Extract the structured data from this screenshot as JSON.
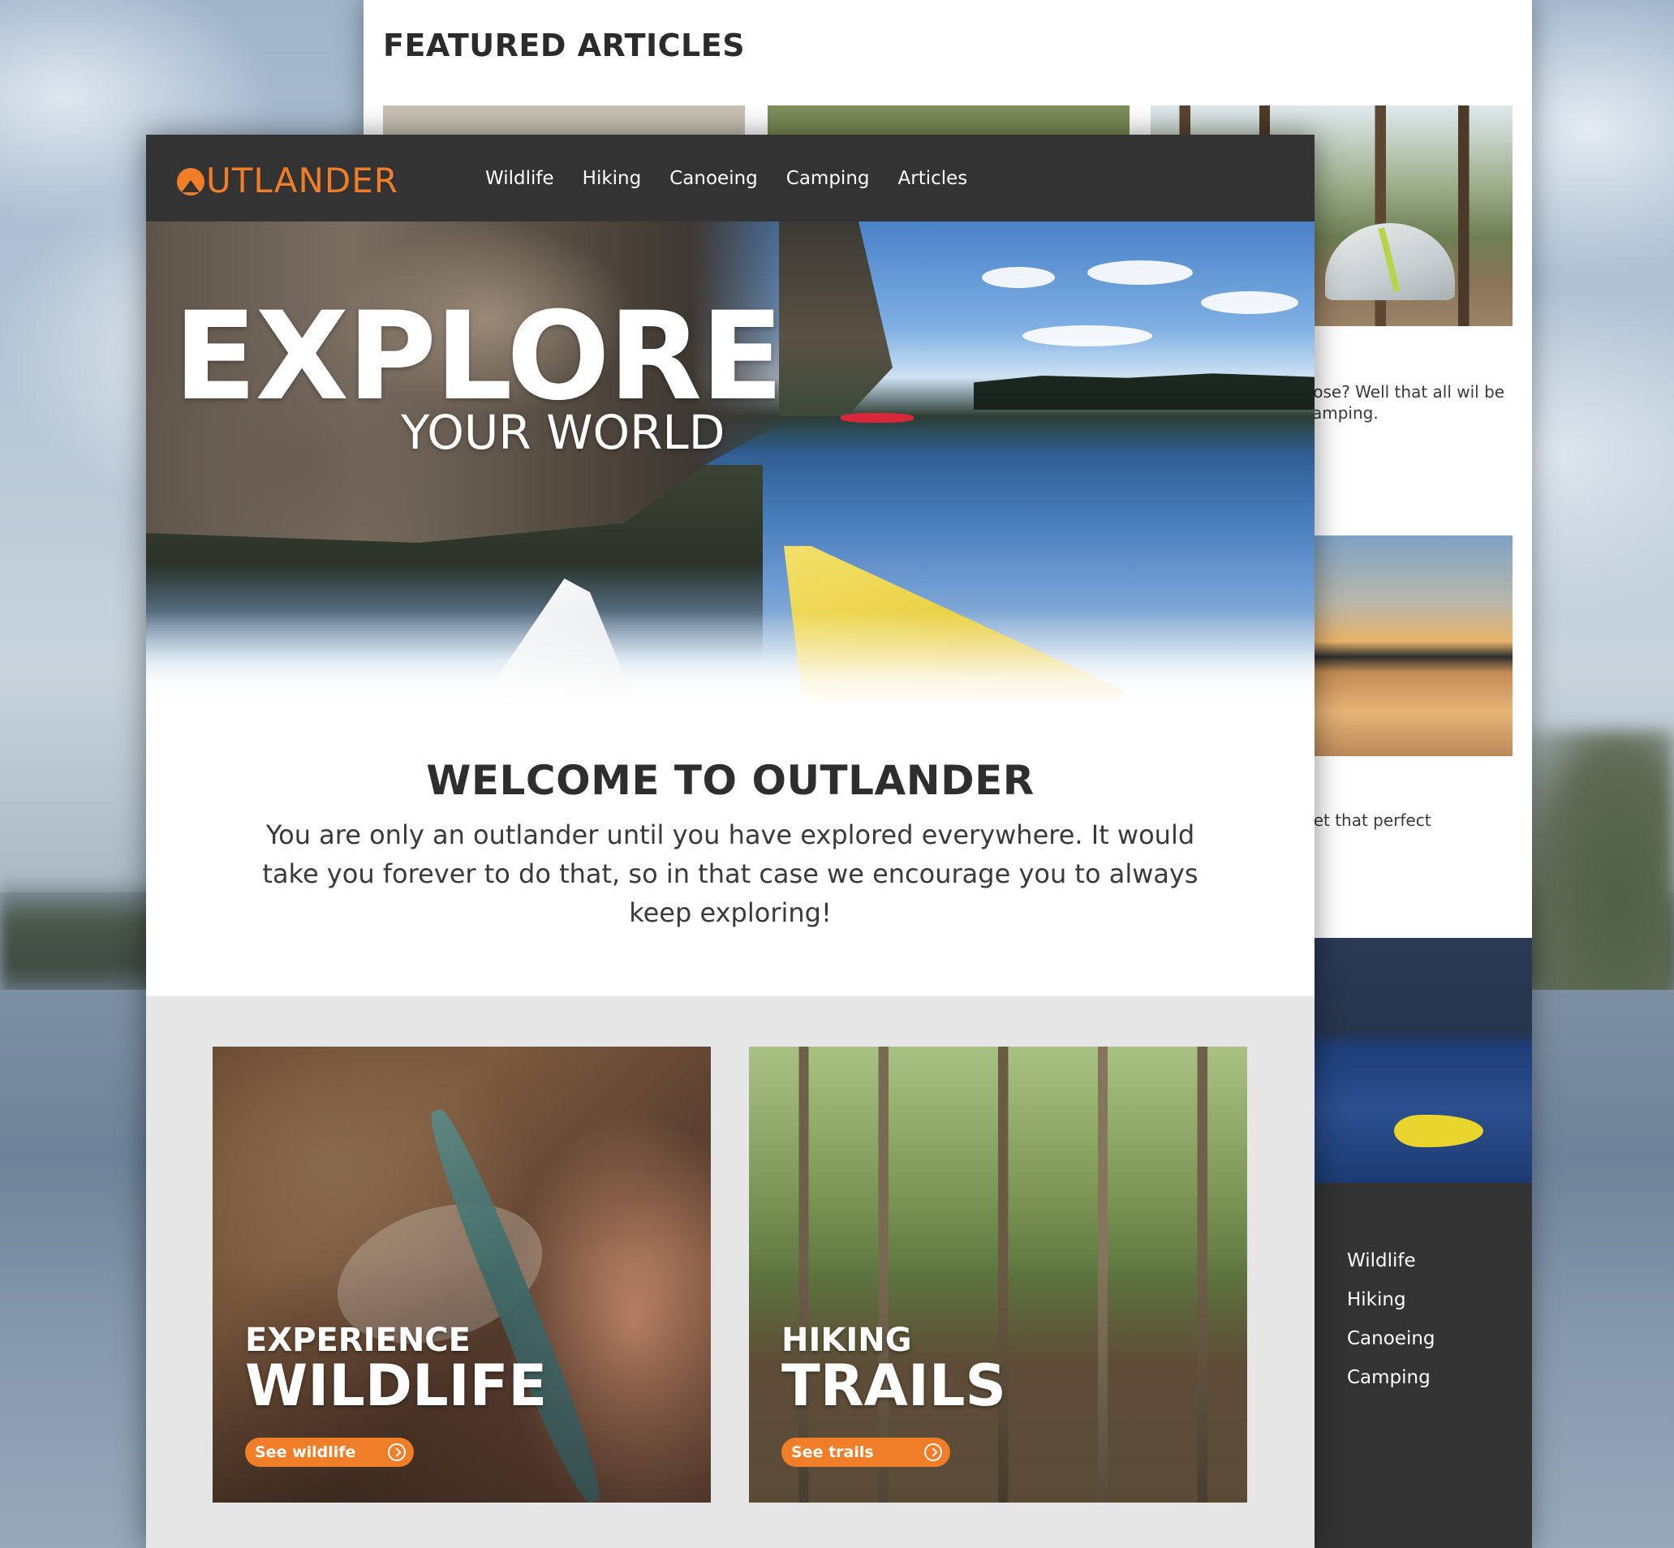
{
  "back_page": {
    "section_title": "FEATURED ARTICLES",
    "snippet_1": "oose? Well that all wil be camping.",
    "snippet_2": "get that perfect",
    "footer_links": [
      "Wildlife",
      "Hiking",
      "Canoeing",
      "Camping"
    ]
  },
  "front_page": {
    "logo": "UTLANDER",
    "logo_icon": "mountain-o-logo-icon",
    "nav": [
      "Wildlife",
      "Hiking",
      "Canoeing",
      "Camping",
      "Articles"
    ],
    "hero": {
      "title": "EXPLORE",
      "subtitle": "YOUR WORLD"
    },
    "welcome": {
      "heading": "WELCOME TO OUTLANDER",
      "body": "You are only an outlander until you have explored everywhere. It would take you forever to do that, so in that case we encourage you to always keep exploring!"
    },
    "cards": [
      {
        "kicker": "EXPERIENCE",
        "title": "WILDLIFE",
        "button": "See wildlife",
        "icon": "arrow-right-circle-icon"
      },
      {
        "kicker": "HIKING",
        "title": "TRAILS",
        "button": "See trails",
        "icon": "arrow-right-circle-icon"
      }
    ]
  },
  "colors": {
    "accent": "#f07d28",
    "nav_bg": "#333333",
    "section_bg": "#e6e6e6",
    "text_dark": "#2e2e2e"
  }
}
